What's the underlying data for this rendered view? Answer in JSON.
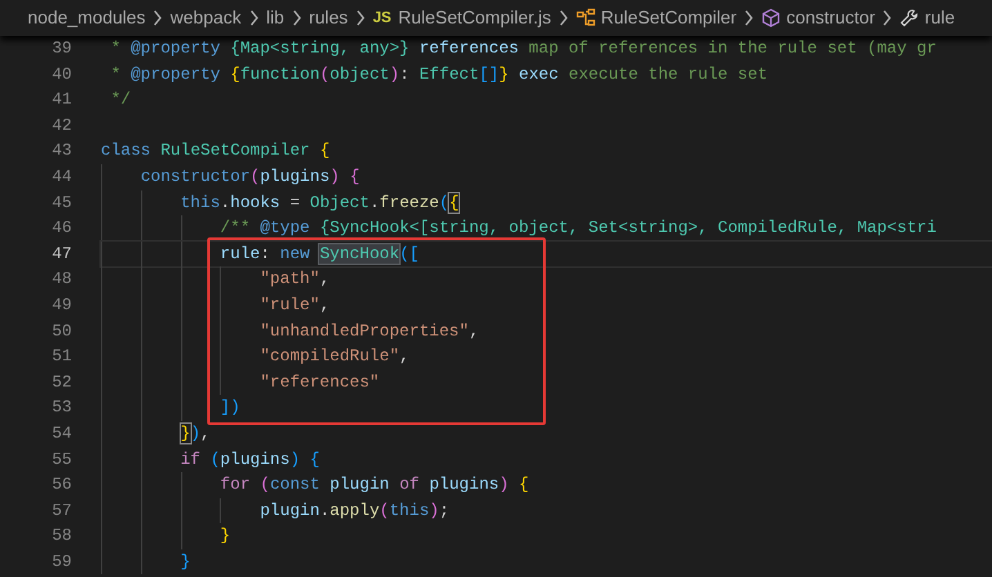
{
  "breadcrumb": [
    {
      "kind": "folder",
      "label": "node_modules"
    },
    {
      "kind": "folder",
      "label": "webpack"
    },
    {
      "kind": "folder",
      "label": "lib"
    },
    {
      "kind": "folder",
      "label": "rules"
    },
    {
      "kind": "js-file",
      "badge": "JS",
      "label": "RuleSetCompiler.js"
    },
    {
      "kind": "class",
      "label": "RuleSetCompiler"
    },
    {
      "kind": "method",
      "label": "constructor"
    },
    {
      "kind": "property",
      "label": "rule"
    }
  ],
  "editor": {
    "lines": [
      {
        "number": "39",
        "current": false,
        "tokens": [
          {
            "kind": "comment",
            "text": " * "
          },
          {
            "kind": "tag",
            "text": "@property"
          },
          {
            "kind": "doctype",
            "text": " {Map<string, any>}"
          },
          {
            "kind": "variable",
            "text": " references"
          },
          {
            "kind": "comment",
            "text": " map of references in the rule set (may gr"
          }
        ]
      },
      {
        "number": "40",
        "current": false,
        "tokens": [
          {
            "kind": "comment",
            "text": " * "
          },
          {
            "kind": "tag",
            "text": "@property"
          },
          {
            "kind": "bracket1",
            "text": " {"
          },
          {
            "kind": "type",
            "text": "function"
          },
          {
            "kind": "bracket2",
            "text": "("
          },
          {
            "kind": "type",
            "text": "object"
          },
          {
            "kind": "bracket2",
            "text": ")"
          },
          {
            "kind": "plain",
            "text": ": "
          },
          {
            "kind": "type",
            "text": "Effect"
          },
          {
            "kind": "bracket3",
            "text": "[]"
          },
          {
            "kind": "bracket1",
            "text": "}"
          },
          {
            "kind": "variable",
            "text": " exec"
          },
          {
            "kind": "comment",
            "text": " execute the rule set"
          }
        ]
      },
      {
        "number": "41",
        "current": false,
        "tokens": [
          {
            "kind": "comment",
            "text": " */"
          }
        ]
      },
      {
        "number": "42",
        "current": false
      },
      {
        "number": "43",
        "current": false,
        "tokens": [
          {
            "kind": "keyword",
            "text": "class"
          },
          {
            "kind": "type",
            "text": " RuleSetCompiler"
          },
          {
            "kind": "bracket1",
            "text": " {"
          }
        ]
      },
      {
        "number": "44",
        "current": false,
        "tokens": [
          {
            "kind": "keyword",
            "text": "    constructor"
          },
          {
            "kind": "bracket2",
            "text": "("
          },
          {
            "kind": "variable",
            "text": "plugins"
          },
          {
            "kind": "bracket2",
            "text": ")"
          },
          {
            "kind": "bracket2",
            "text": " {"
          }
        ]
      },
      {
        "number": "45",
        "current": false,
        "tokens": [
          {
            "kind": "keyword",
            "text": "        this"
          },
          {
            "kind": "plain",
            "text": "."
          },
          {
            "kind": "variable",
            "text": "hooks"
          },
          {
            "kind": "plain",
            "text": " = "
          },
          {
            "kind": "type",
            "text": "Object"
          },
          {
            "kind": "plain",
            "text": "."
          },
          {
            "kind": "function",
            "text": "freeze"
          },
          {
            "kind": "bracket3",
            "text": "("
          },
          {
            "kind": "bracket-match",
            "text": "{"
          }
        ]
      },
      {
        "number": "46",
        "current": false,
        "tokens": [
          {
            "kind": "comment",
            "text": "            /** "
          },
          {
            "kind": "tag",
            "text": "@type"
          },
          {
            "kind": "doctype",
            "text": " {SyncHook<[string, object, Set<string>, CompiledRule, Map<stri"
          }
        ]
      },
      {
        "number": "47",
        "current": true,
        "tokens": [
          {
            "kind": "variable",
            "text": "            rule"
          },
          {
            "kind": "plain",
            "text": ": "
          },
          {
            "kind": "keyword",
            "text": "new"
          },
          {
            "kind": "type-match",
            "text": " SyncHook"
          },
          {
            "kind": "bracket3",
            "text": "(["
          }
        ]
      },
      {
        "number": "48",
        "current": false,
        "tokens": [
          {
            "kind": "string",
            "text": "                \"path\""
          },
          {
            "kind": "plain",
            "text": ","
          }
        ]
      },
      {
        "number": "49",
        "current": false,
        "tokens": [
          {
            "kind": "string",
            "text": "                \"rule\""
          },
          {
            "kind": "plain",
            "text": ","
          }
        ]
      },
      {
        "number": "50",
        "current": false,
        "tokens": [
          {
            "kind": "string",
            "text": "                \"unhandledProperties\""
          },
          {
            "kind": "plain",
            "text": ","
          }
        ]
      },
      {
        "number": "51",
        "current": false,
        "tokens": [
          {
            "kind": "string",
            "text": "                \"compiledRule\""
          },
          {
            "kind": "plain",
            "text": ","
          }
        ]
      },
      {
        "number": "52",
        "current": false,
        "tokens": [
          {
            "kind": "string",
            "text": "                \"references\""
          }
        ]
      },
      {
        "number": "53",
        "current": false,
        "tokens": [
          {
            "kind": "bracket3",
            "text": "            ])"
          }
        ]
      },
      {
        "number": "54",
        "current": false,
        "tokens": [
          {
            "kind": "bracket-match",
            "text": "        }"
          },
          {
            "kind": "bracket3",
            "text": ")"
          },
          {
            "kind": "plain",
            "text": ","
          }
        ]
      },
      {
        "number": "55",
        "current": false,
        "tokens": [
          {
            "kind": "control",
            "text": "        if"
          },
          {
            "kind": "bracket3",
            "text": " ("
          },
          {
            "kind": "variable",
            "text": "plugins"
          },
          {
            "kind": "bracket3",
            "text": ")"
          },
          {
            "kind": "bracket3",
            "text": " {"
          }
        ]
      },
      {
        "number": "56",
        "current": false,
        "tokens": [
          {
            "kind": "control",
            "text": "            for"
          },
          {
            "kind": "bracket2",
            "text": " ("
          },
          {
            "kind": "keyword",
            "text": "const"
          },
          {
            "kind": "variable",
            "text": " plugin"
          },
          {
            "kind": "control",
            "text": " of"
          },
          {
            "kind": "variable",
            "text": " plugins"
          },
          {
            "kind": "bracket2",
            "text": ")"
          },
          {
            "kind": "bracket1",
            "text": " {"
          }
        ]
      },
      {
        "number": "57",
        "current": false,
        "tokens": [
          {
            "kind": "variable",
            "text": "                plugin"
          },
          {
            "kind": "plain",
            "text": "."
          },
          {
            "kind": "function",
            "text": "apply"
          },
          {
            "kind": "bracket2",
            "text": "("
          },
          {
            "kind": "keyword",
            "text": "this"
          },
          {
            "kind": "bracket2",
            "text": ")"
          },
          {
            "kind": "plain",
            "text": ";"
          }
        ]
      },
      {
        "number": "58",
        "current": false,
        "tokens": [
          {
            "kind": "bracket1",
            "text": "            }"
          }
        ]
      },
      {
        "number": "59",
        "current": false,
        "tokens": [
          {
            "kind": "bracket3",
            "text": "        }"
          }
        ]
      }
    ]
  }
}
